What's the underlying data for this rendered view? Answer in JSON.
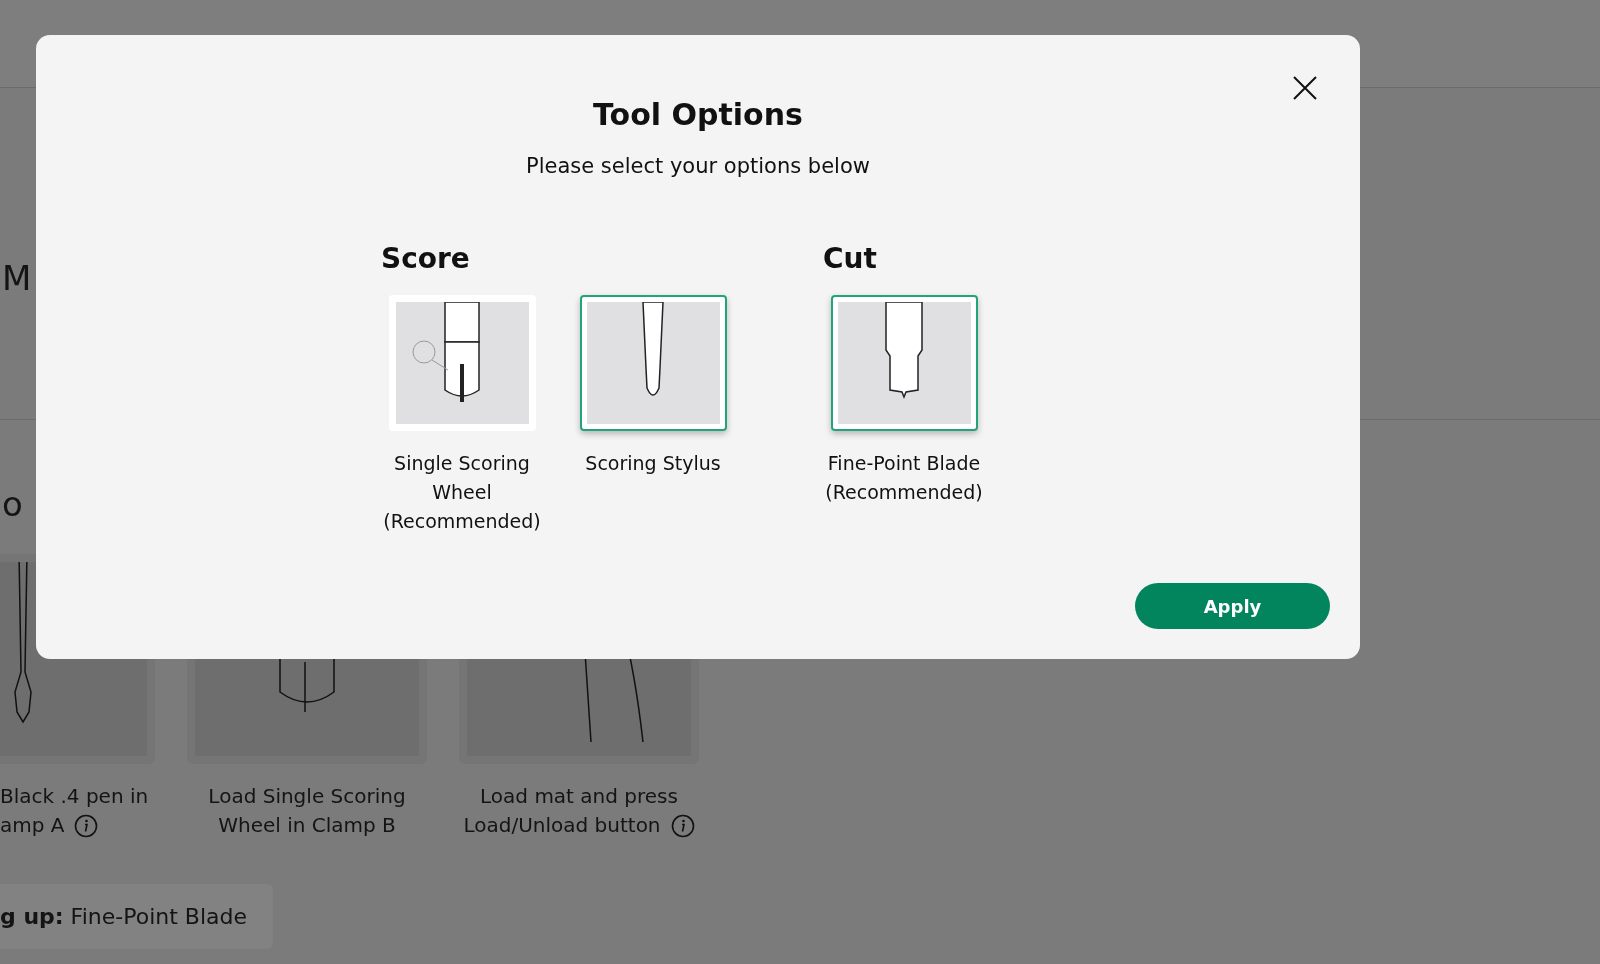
{
  "page": {
    "section_heading": "M",
    "tools_heading": "o",
    "steps": [
      {
        "kind": "pen",
        "lines": [
          "Black .4 pen in",
          "amp A"
        ],
        "info": true
      },
      {
        "kind": "wheel",
        "lines": [
          "Load Single Scoring",
          "Wheel in Clamp B"
        ],
        "info": false
      },
      {
        "kind": "finger",
        "lines": [
          "Load mat and press",
          "Load/Unload button"
        ],
        "info": true
      }
    ],
    "next_up": "**g up:** Fine-Point Blade"
  },
  "dialog": {
    "title": "Tool Options",
    "subtitle": "Please select your options below",
    "groups": [
      {
        "heading": "Score",
        "options": [
          {
            "kind": "wheel",
            "label": "Single Scoring Wheel (Recommended)",
            "selected": false
          },
          {
            "kind": "stylus",
            "label": "Scoring Stylus",
            "selected": true
          }
        ]
      },
      {
        "heading": "Cut",
        "options": [
          {
            "kind": "blade",
            "label": "Fine-Point Blade (Recommended)",
            "selected": true
          }
        ]
      }
    ],
    "apply": "Apply"
  }
}
